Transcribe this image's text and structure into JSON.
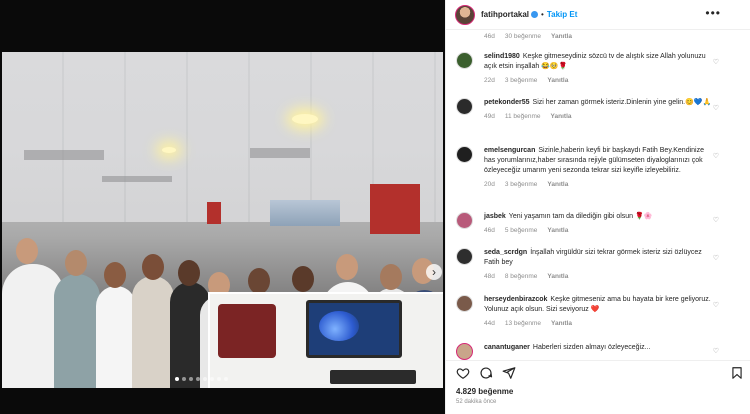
{
  "post": {
    "author": "fatihportakal",
    "follow_label": "Takip Et",
    "separator": "•",
    "more_label": "•••",
    "likes": "4.829 beğenme",
    "time_ago": "52 dakika önce"
  },
  "comments": {
    "top_meta": {
      "age": "46d",
      "likes": "30 beğenme",
      "reply": "Yanıtla"
    },
    "items": [
      {
        "user": "selind1980",
        "text": "Keşke gitmeseydiniz sözcü tv de alıştık size Allah yolunuzu açık etsin inşallah 😂🥺🌹",
        "age": "22d",
        "likes": "3 beğenme",
        "reply": "Yanıtla",
        "avatar_color": "#3b5f2e"
      },
      {
        "user": "petekonder55",
        "text": "Sizi her zaman görmek isteriz.Dinlenin yine gelin.😊💙🙏",
        "age": "49d",
        "likes": "11 beğenme",
        "reply": "Yanıtla",
        "avatar_color": "#2b2b2b"
      },
      {
        "user": "emelsengurcan",
        "text": "Sizinle,haberin keyfi bir başkaydı Fatih Bey.Kendinize has yorumlarınız,haber sırasında rejiyle gülümseten diyaloglarınızı çok özleyeceğiz umarım yeni sezonda tekrar sizi keyifle izleyebiliriz.",
        "age": "20d",
        "likes": "3 beğenme",
        "reply": "Yanıtla",
        "avatar_color": "#1f1f1f"
      },
      {
        "user": "jasbek",
        "text": "Yeni yaşamın tam da dilediğin gibi olsun 🌹🌸",
        "age": "46d",
        "likes": "5 beğenme",
        "reply": "Yanıtla",
        "avatar_color": "#b85a7a"
      },
      {
        "user": "seda_scrdgn",
        "text": "İnşallah virgüldür sizi tekrar görmek isteriz sizi özlüycez Fatih bey",
        "age": "48d",
        "likes": "8 beğenme",
        "reply": "Yanıtla",
        "avatar_color": "#2e2e2e"
      },
      {
        "user": "herseydenbirazcok",
        "text": "Keşke gitmeseniz ama bu hayata bir kere geliyoruz. Yolunuz açık olsun. Sizi seviyoruz ❤️",
        "age": "44d",
        "likes": "13 beğenme",
        "reply": "Yanıtla",
        "avatar_color": "#7a5a4a"
      },
      {
        "user": "canantuganer",
        "text": "Haberleri sizden almayı özleyeceğiz...",
        "age": "",
        "likes": "",
        "reply": "",
        "avatar_color": "#c9a58a"
      }
    ]
  },
  "icons": {
    "heart": "heart-icon",
    "comment": "comment-icon",
    "share": "share-icon",
    "save": "bookmark-icon",
    "more": "more-icon",
    "next": "chevron-right-icon"
  },
  "colors": {
    "link": "#0095f6",
    "verified": "#3897f0",
    "muted": "#8e8e8e",
    "text": "#262626"
  }
}
